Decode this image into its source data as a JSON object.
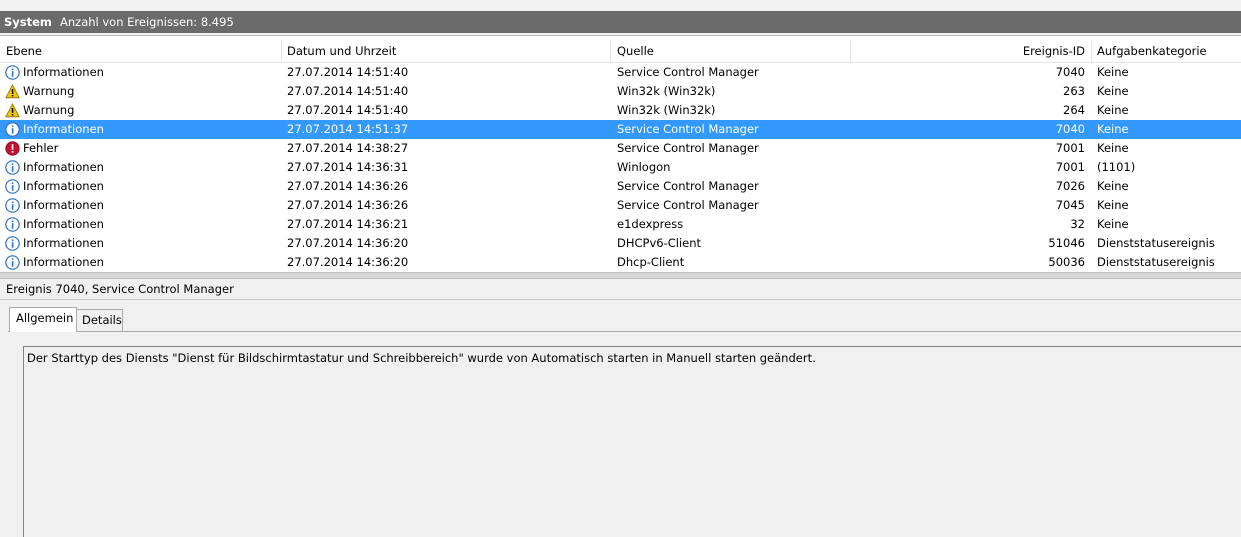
{
  "header": {
    "log_name": "System",
    "event_count": "Anzahl von Ereignissen: 8.495"
  },
  "columns": {
    "level": "Ebene",
    "datetime": "Datum und Uhrzeit",
    "source": "Quelle",
    "event_id": "Ereignis-ID",
    "task_category": "Aufgabenkategorie"
  },
  "events": [
    {
      "icon": "info-icon",
      "level": "Informationen",
      "datetime": "27.07.2014 14:51:40",
      "source": "Service Control Manager",
      "event_id": "7040",
      "category": "Keine"
    },
    {
      "icon": "warning-icon",
      "level": "Warnung",
      "datetime": "27.07.2014 14:51:40",
      "source": "Win32k (Win32k)",
      "event_id": "263",
      "category": "Keine"
    },
    {
      "icon": "warning-icon",
      "level": "Warnung",
      "datetime": "27.07.2014 14:51:40",
      "source": "Win32k (Win32k)",
      "event_id": "264",
      "category": "Keine"
    },
    {
      "icon": "info-icon",
      "level": "Informationen",
      "datetime": "27.07.2014 14:51:37",
      "source": "Service Control Manager",
      "event_id": "7040",
      "category": "Keine"
    },
    {
      "icon": "error-icon",
      "level": "Fehler",
      "datetime": "27.07.2014 14:38:27",
      "source": "Service Control Manager",
      "event_id": "7001",
      "category": "Keine"
    },
    {
      "icon": "info-icon",
      "level": "Informationen",
      "datetime": "27.07.2014 14:36:31",
      "source": "Winlogon",
      "event_id": "7001",
      "category": "(1101)"
    },
    {
      "icon": "info-icon",
      "level": "Informationen",
      "datetime": "27.07.2014 14:36:26",
      "source": "Service Control Manager",
      "event_id": "7026",
      "category": "Keine"
    },
    {
      "icon": "info-icon",
      "level": "Informationen",
      "datetime": "27.07.2014 14:36:26",
      "source": "Service Control Manager",
      "event_id": "7045",
      "category": "Keine"
    },
    {
      "icon": "info-icon",
      "level": "Informationen",
      "datetime": "27.07.2014 14:36:21",
      "source": "e1dexpress",
      "event_id": "32",
      "category": "Keine"
    },
    {
      "icon": "info-icon",
      "level": "Informationen",
      "datetime": "27.07.2014 14:36:20",
      "source": "DHCPv6-Client",
      "event_id": "51046",
      "category": "Dienststatusereignis"
    },
    {
      "icon": "info-icon",
      "level": "Informationen",
      "datetime": "27.07.2014 14:36:20",
      "source": "Dhcp-Client",
      "event_id": "50036",
      "category": "Dienststatusereignis"
    }
  ],
  "selected_index": 3,
  "detail": {
    "title": "Ereignis 7040, Service Control Manager",
    "tabs": [
      "Allgemein",
      "Details"
    ],
    "active_tab": "Allgemein",
    "message": "Der Starttyp des Diensts \"Dienst für Bildschirmtastatur und Schreibbereich\" wurde von Automatisch starten in Manuell starten geändert."
  },
  "colors": {
    "selection": "#3399ff",
    "titlebar": "#6b6b6b",
    "info": "#2f6fc4",
    "warning": "#f2c500",
    "error": "#c8102e"
  }
}
